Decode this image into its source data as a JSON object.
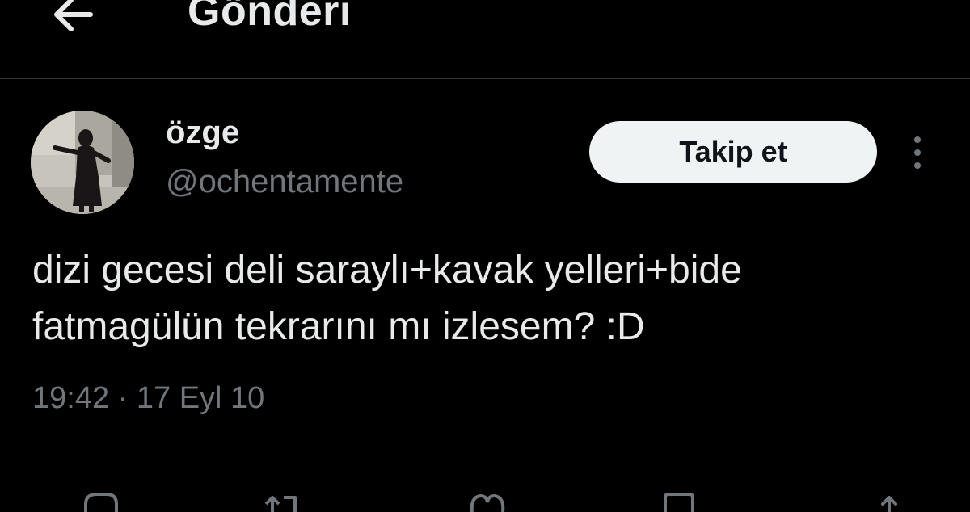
{
  "header": {
    "back_icon": "arrow-left-icon",
    "title": "Gönderi"
  },
  "tweet": {
    "author": {
      "display_name": "özge",
      "handle": "@ochentamente",
      "avatar_icon": "avatar-photo"
    },
    "follow_label": "Takip et",
    "more_icon": "more-vertical-icon",
    "text": "dizi gecesi deli saraylı+kavak yelleri+bide\nfatmagülün tekrarını mı izlesem? :D",
    "timestamp": "19:42 · 17 Eyl 10"
  },
  "actions": {
    "icons": [
      "reply-icon",
      "retweet-icon",
      "like-icon",
      "bookmark-icon",
      "share-icon"
    ]
  },
  "colors": {
    "background": "#000000",
    "text_primary": "#e7e9ea",
    "text_secondary": "#71767b",
    "divider": "#2f3336",
    "follow_bg": "#eff3f4",
    "follow_text": "#0f1419"
  }
}
